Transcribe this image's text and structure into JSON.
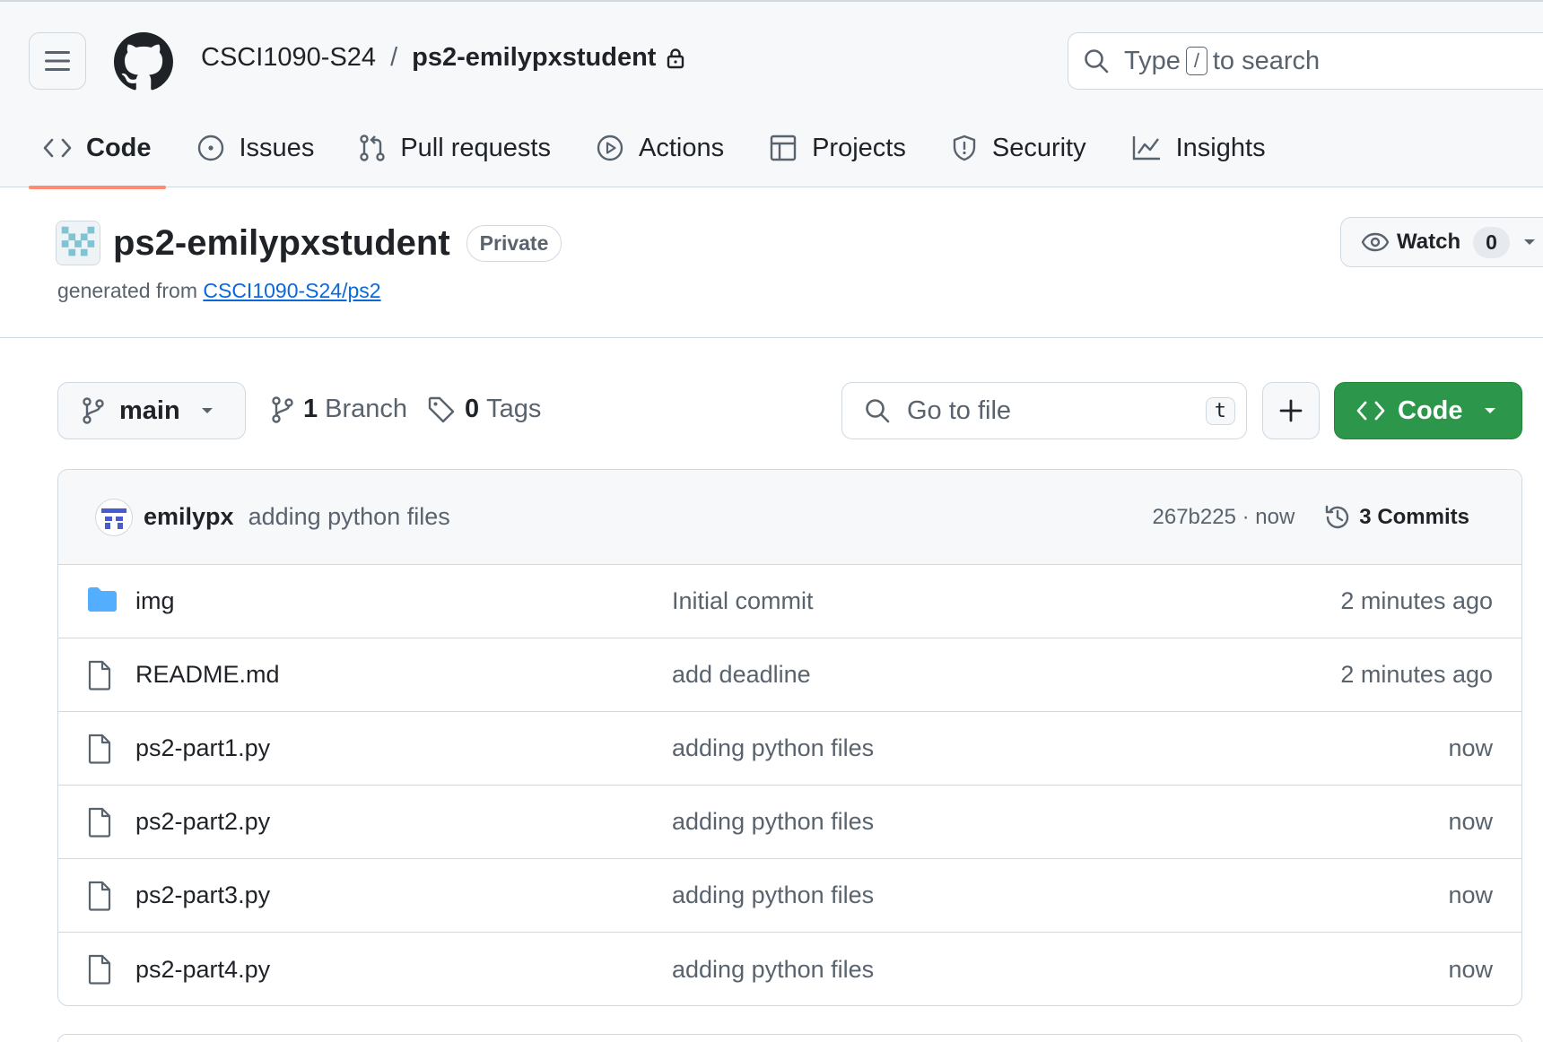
{
  "header": {
    "org": "CSCI1090-S24",
    "separator": "/",
    "repo": "ps2-emilypxstudent",
    "search_prefix": "Type",
    "search_key": "/",
    "search_suffix": "to search"
  },
  "tabs": [
    {
      "label": "Code",
      "icon": "code-icon",
      "selected": true
    },
    {
      "label": "Issues",
      "icon": "issue-icon"
    },
    {
      "label": "Pull requests",
      "icon": "pull-request-icon"
    },
    {
      "label": "Actions",
      "icon": "play-icon"
    },
    {
      "label": "Projects",
      "icon": "table-icon"
    },
    {
      "label": "Security",
      "icon": "shield-icon"
    },
    {
      "label": "Insights",
      "icon": "graph-icon"
    }
  ],
  "repo": {
    "name": "ps2-emilypxstudent",
    "visibility": "Private",
    "generated_prefix": "generated from",
    "template_link": "CSCI1090-S24/ps2"
  },
  "watch": {
    "label": "Watch",
    "count": "0"
  },
  "toolbar": {
    "branch": "main",
    "branch_count": "1",
    "branch_label": "Branch",
    "tag_count": "0",
    "tag_label": "Tags",
    "goto_placeholder": "Go to file",
    "goto_key": "t",
    "code_label": "Code"
  },
  "commit": {
    "author": "emilypx",
    "message": "adding python files",
    "sha_time": "267b225 · now",
    "commits_label": "3 Commits"
  },
  "files": [
    {
      "name": "img",
      "type": "folder",
      "message": "Initial commit",
      "time": "2 minutes ago"
    },
    {
      "name": "README.md",
      "type": "file",
      "message": "add deadline",
      "time": "2 minutes ago"
    },
    {
      "name": "ps2-part1.py",
      "type": "file",
      "message": "adding python files",
      "time": "now"
    },
    {
      "name": "ps2-part2.py",
      "type": "file",
      "message": "adding python files",
      "time": "now"
    },
    {
      "name": "ps2-part3.py",
      "type": "file",
      "message": "adding python files",
      "time": "now"
    },
    {
      "name": "ps2-part4.py",
      "type": "file",
      "message": "adding python files",
      "time": "now"
    }
  ],
  "colors": {
    "accent_underline": "#fd8c73",
    "code_button": "#2c974b",
    "link": "#0969da",
    "folder": "#54aeff"
  }
}
